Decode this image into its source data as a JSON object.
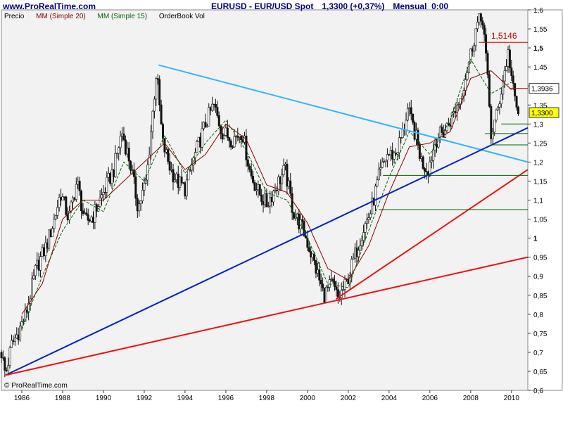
{
  "header": {
    "url": "www.ProRealTime.com",
    "instrument": "EURUSD - EUR/USD Spot",
    "price_change": "1,3300 (+0,37%)",
    "period": "Mensual  0:00"
  },
  "legend": {
    "price": "Precio",
    "ma20": "MM (Simple 20)",
    "ma15": "MM (Simple 15)",
    "orderbook": "OrderBook Vol"
  },
  "copyright": "© ProRealTime.com",
  "colors": {
    "background": "#f2f2f2",
    "candle": "#111111",
    "ma20": "#8b0000",
    "ma15": "#006400",
    "resistance": "#33b5ff",
    "support_blue": "#0022cc",
    "support_red": "#ee1111",
    "hline_green": "#006400",
    "hline_red": "#cc0000",
    "header_text": "#000080"
  },
  "chart_data": {
    "type": "candlestick",
    "title": "EURUSD - EUR/USD Spot",
    "xlim": [
      1985.0,
      2010.8
    ],
    "ylim": [
      0.6,
      1.6
    ],
    "x_ticks": [
      "1986",
      "1988",
      "1990",
      "1992",
      "1994",
      "1996",
      "1998",
      "2000",
      "2002",
      "2004",
      "2006",
      "2008",
      "2010"
    ],
    "y_ticks": [
      "0,6",
      "0,65",
      "0,7",
      "0,75",
      "0,8",
      "0,85",
      "0,9",
      "0,95",
      "1",
      "1,05",
      "1,1",
      "1,15",
      "1,2",
      "1,25",
      "1,3",
      "1,35",
      "1,4",
      "1,45",
      "1,5",
      "1,55",
      "1,6"
    ],
    "price_path": [
      [
        1985.0,
        0.7
      ],
      [
        1985.2,
        0.64
      ],
      [
        1985.5,
        0.72
      ],
      [
        1985.8,
        0.75
      ],
      [
        1986.2,
        0.8
      ],
      [
        1986.7,
        0.92
      ],
      [
        1987.2,
        0.98
      ],
      [
        1987.6,
        1.05
      ],
      [
        1987.9,
        1.12
      ],
      [
        1988.3,
        1.05
      ],
      [
        1988.7,
        1.15
      ],
      [
        1989.1,
        1.04
      ],
      [
        1989.5,
        1.06
      ],
      [
        1990.0,
        1.12
      ],
      [
        1990.5,
        1.18
      ],
      [
        1990.9,
        1.28
      ],
      [
        1991.3,
        1.2
      ],
      [
        1991.7,
        1.08
      ],
      [
        1992.1,
        1.15
      ],
      [
        1992.4,
        1.32
      ],
      [
        1992.6,
        1.44
      ],
      [
        1992.9,
        1.25
      ],
      [
        1993.3,
        1.18
      ],
      [
        1993.6,
        1.15
      ],
      [
        1994.0,
        1.13
      ],
      [
        1994.5,
        1.22
      ],
      [
        1995.0,
        1.3
      ],
      [
        1995.4,
        1.35
      ],
      [
        1995.8,
        1.28
      ],
      [
        1996.3,
        1.26
      ],
      [
        1996.8,
        1.28
      ],
      [
        1997.2,
        1.17
      ],
      [
        1997.6,
        1.12
      ],
      [
        1998.0,
        1.09
      ],
      [
        1998.5,
        1.14
      ],
      [
        1998.9,
        1.18
      ],
      [
        1999.3,
        1.07
      ],
      [
        1999.8,
        1.02
      ],
      [
        2000.3,
        0.94
      ],
      [
        2000.8,
        0.85
      ],
      [
        2001.2,
        0.88
      ],
      [
        2001.5,
        0.84
      ],
      [
        2001.9,
        0.88
      ],
      [
        2002.3,
        0.95
      ],
      [
        2002.7,
        1.02
      ],
      [
        2003.1,
        1.07
      ],
      [
        2003.5,
        1.16
      ],
      [
        2003.9,
        1.22
      ],
      [
        2004.3,
        1.22
      ],
      [
        2004.7,
        1.28
      ],
      [
        2004.9,
        1.34
      ],
      [
        2005.3,
        1.27
      ],
      [
        2005.6,
        1.2
      ],
      [
        2005.9,
        1.18
      ],
      [
        2006.3,
        1.26
      ],
      [
        2006.7,
        1.28
      ],
      [
        2007.1,
        1.32
      ],
      [
        2007.5,
        1.37
      ],
      [
        2007.9,
        1.46
      ],
      [
        2008.3,
        1.56
      ],
      [
        2008.6,
        1.58
      ],
      [
        2008.85,
        1.4
      ],
      [
        2009.0,
        1.27
      ],
      [
        2009.3,
        1.33
      ],
      [
        2009.6,
        1.42
      ],
      [
        2009.85,
        1.49
      ],
      [
        2010.1,
        1.38
      ],
      [
        2010.3,
        1.33
      ]
    ],
    "ma20_path": [
      [
        1986.0,
        0.8
      ],
      [
        1987.0,
        0.88
      ],
      [
        1988.0,
        1.05
      ],
      [
        1989.0,
        1.1
      ],
      [
        1990.0,
        1.1
      ],
      [
        1991.0,
        1.15
      ],
      [
        1992.0,
        1.2
      ],
      [
        1993.0,
        1.25
      ],
      [
        1994.0,
        1.18
      ],
      [
        1995.0,
        1.22
      ],
      [
        1996.0,
        1.3
      ],
      [
        1997.0,
        1.26
      ],
      [
        1998.0,
        1.14
      ],
      [
        1999.0,
        1.12
      ],
      [
        2000.0,
        1.04
      ],
      [
        2001.0,
        0.92
      ],
      [
        2002.0,
        0.89
      ],
      [
        2003.0,
        0.98
      ],
      [
        2004.0,
        1.12
      ],
      [
        2005.0,
        1.24
      ],
      [
        2006.0,
        1.25
      ],
      [
        2007.0,
        1.28
      ],
      [
        2008.0,
        1.42
      ],
      [
        2009.0,
        1.44
      ],
      [
        2010.0,
        1.39
      ]
    ],
    "ma15_path": [
      [
        1986.0,
        0.76
      ],
      [
        1987.0,
        0.9
      ],
      [
        1988.0,
        1.02
      ],
      [
        1989.0,
        1.1
      ],
      [
        1990.0,
        1.07
      ],
      [
        1991.0,
        1.2
      ],
      [
        1992.0,
        1.15
      ],
      [
        1993.0,
        1.27
      ],
      [
        1994.0,
        1.17
      ],
      [
        1995.0,
        1.25
      ],
      [
        1996.0,
        1.31
      ],
      [
        1997.0,
        1.23
      ],
      [
        1998.0,
        1.12
      ],
      [
        1999.0,
        1.1
      ],
      [
        2000.0,
        1.0
      ],
      [
        2001.0,
        0.88
      ],
      [
        2002.0,
        0.87
      ],
      [
        2003.0,
        1.02
      ],
      [
        2004.0,
        1.16
      ],
      [
        2005.0,
        1.28
      ],
      [
        2006.0,
        1.22
      ],
      [
        2007.0,
        1.31
      ],
      [
        2008.0,
        1.47
      ],
      [
        2009.0,
        1.38
      ],
      [
        2010.0,
        1.41
      ]
    ],
    "trendlines": [
      {
        "color": "resistance",
        "from": [
          1992.7,
          1.455
        ],
        "to": [
          2010.8,
          1.2
        ]
      },
      {
        "color": "support_blue",
        "from": [
          1985.2,
          0.64
        ],
        "to": [
          2010.8,
          1.29
        ]
      },
      {
        "color": "support_red",
        "from": [
          1985.2,
          0.64
        ],
        "to": [
          2010.8,
          0.95
        ]
      },
      {
        "color": "support_red",
        "from": [
          2001.4,
          0.84
        ],
        "to": [
          2010.8,
          1.18
        ]
      }
    ],
    "horizontal_lines": [
      {
        "color": "hline_red",
        "y": 1.5146,
        "x_from": 2008.4
      },
      {
        "color": "hline_red",
        "y": 1.3936,
        "x_from": 2009.9
      },
      {
        "color": "hline_green",
        "y": 1.3,
        "x_from": 2009.5
      },
      {
        "color": "hline_green",
        "y": 1.275,
        "x_from": 2008.7
      },
      {
        "color": "hline_green",
        "y": 1.245,
        "x_from": 2009.0
      },
      {
        "color": "hline_green",
        "y": 1.165,
        "x_from": 2003.7
      },
      {
        "color": "hline_green",
        "y": 1.075,
        "x_from": 2003.5
      }
    ],
    "annotations": [
      {
        "text": "1,5146",
        "x": 2009.0,
        "y": 1.5146,
        "color": "hline_red"
      }
    ],
    "price_labels": [
      {
        "text": "1,3936",
        "y": 1.3936,
        "style": "white"
      },
      {
        "text": "1,3300",
        "y": 1.33,
        "style": "yellow"
      }
    ]
  }
}
